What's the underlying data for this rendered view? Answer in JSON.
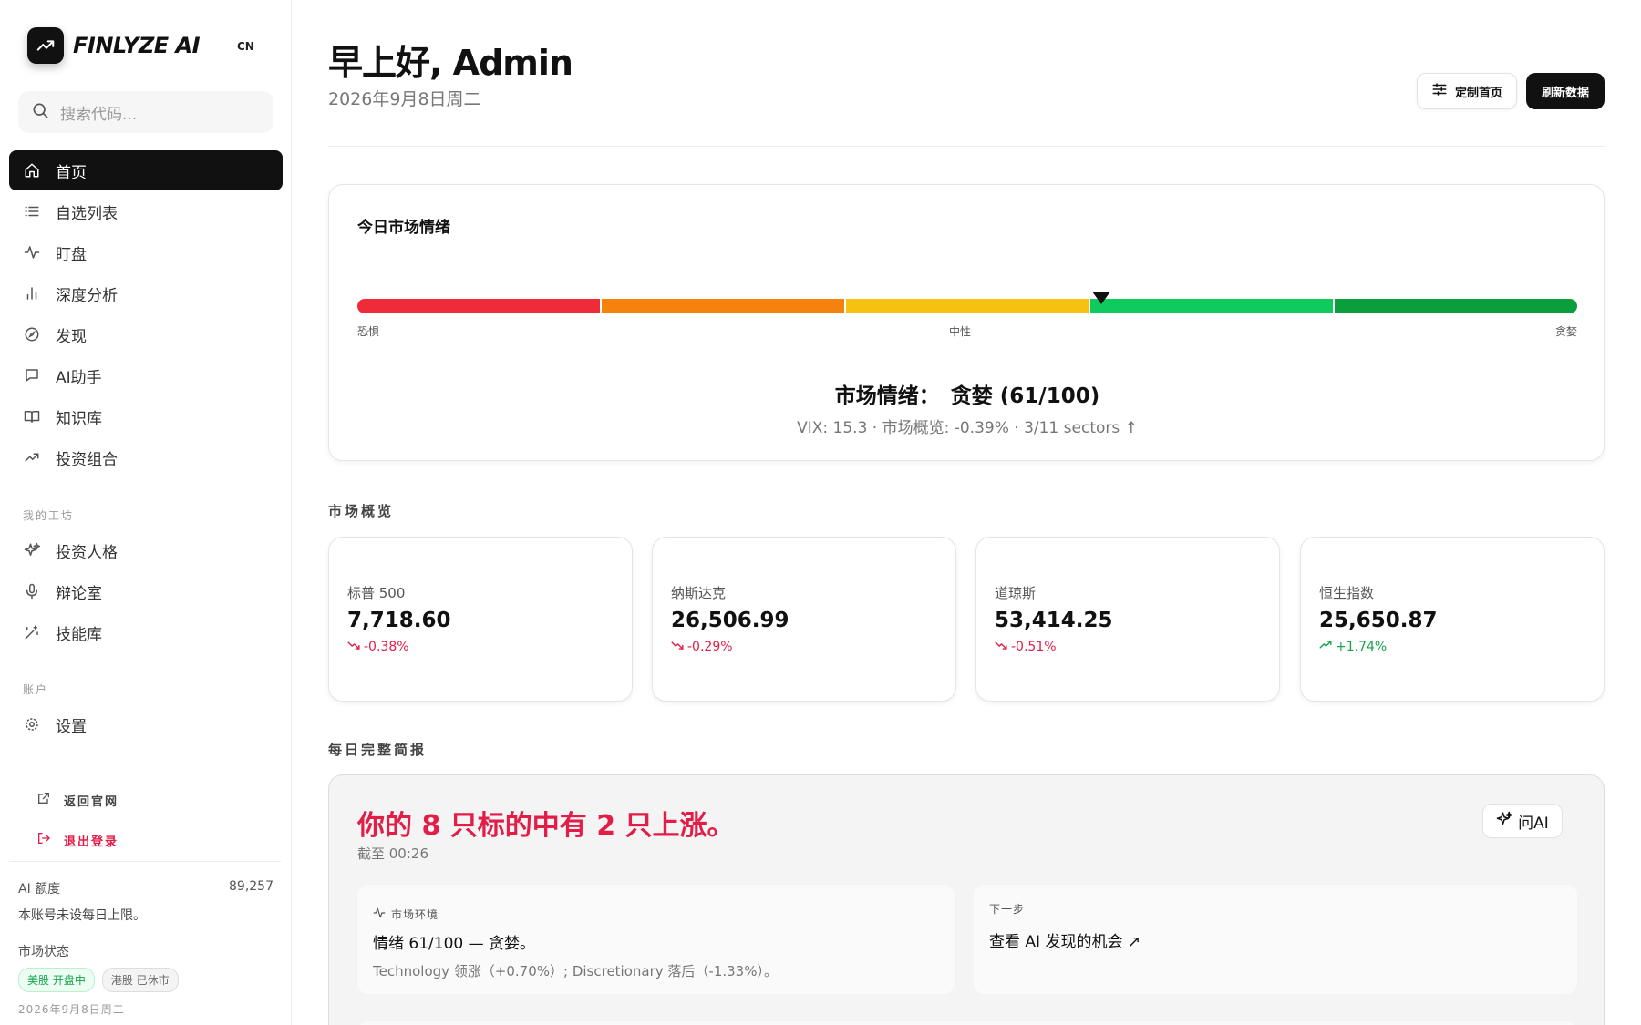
{
  "brand": {
    "name": "FINLYZE AI",
    "lang": "CN"
  },
  "search": {
    "placeholder": "搜索代码..."
  },
  "nav": [
    {
      "label": "首页",
      "icon": "home-icon",
      "active": true
    },
    {
      "label": "自选列表",
      "icon": "list-icon"
    },
    {
      "label": "盯盘",
      "icon": "pulse-icon"
    },
    {
      "label": "深度分析",
      "icon": "bar-chart-icon"
    },
    {
      "label": "发现",
      "icon": "compass-icon"
    },
    {
      "label": "AI助手",
      "icon": "chat-icon"
    },
    {
      "label": "知识库",
      "icon": "book-icon"
    },
    {
      "label": "投资组合",
      "icon": "trend-up-icon"
    }
  ],
  "workshop": {
    "title": "我的工坊",
    "items": [
      {
        "label": "投资人格",
        "icon": "sparkles-icon"
      },
      {
        "label": "辩论室",
        "icon": "mic-icon"
      },
      {
        "label": "技能库",
        "icon": "magic-wand-icon"
      }
    ]
  },
  "account": {
    "title": "账户",
    "items": [
      {
        "label": "设置",
        "icon": "gear-icon"
      }
    ]
  },
  "links": {
    "back": "返回官网",
    "logout": "退出登录"
  },
  "quota": {
    "label": "AI 额度",
    "value": "89,257",
    "note": "本账号未设每日上限。",
    "market_status_label": "市场状态",
    "us": "美股 开盘中",
    "hk": "港股 已休市",
    "date": "2026年9月8日周二"
  },
  "header": {
    "greeting": "早上好, Admin",
    "date": "2026年9月8日周二",
    "customize": "定制首页",
    "refresh": "刷新数据"
  },
  "sentiment": {
    "title": "今日市场情绪",
    "score": 61,
    "scale_max": 100,
    "label_low": "恐惧",
    "label_mid": "中性",
    "label_high": "贪婪",
    "headline": "市场情绪：",
    "value": "贪婪 (61/100)",
    "sub": "VIX: 15.3 · 市场概览: -0.39% · 3/11 sectors ↑",
    "colors": [
      "#ef2b3a",
      "#f5820d",
      "#f5c211",
      "#0fca5c",
      "#0a9e3c"
    ]
  },
  "overview": {
    "title": "市场概览",
    "indices": [
      {
        "name": "标普 500",
        "value": "7,718.60",
        "change": "-0.38%",
        "dir": "down"
      },
      {
        "name": "纳斯达克",
        "value": "26,506.99",
        "change": "-0.29%",
        "dir": "down"
      },
      {
        "name": "道琼斯",
        "value": "53,414.25",
        "change": "-0.51%",
        "dir": "down"
      },
      {
        "name": "恒生指数",
        "value": "25,650.87",
        "change": "+1.74%",
        "dir": "up"
      }
    ]
  },
  "brief": {
    "section": "每日完整简报",
    "title": "你的 8 只标的中有 2 只上涨。",
    "time": "截至 00:26",
    "ask_ai": "问AI",
    "env_label": "市场环境",
    "env_main": "情绪 61/100 — 贪婪。",
    "env_note": "Technology 领涨（+0.70%）; Discretionary 落后（-1.33%）。",
    "next_label": "下一步",
    "next_main": "查看 AI 发现的机会 ↗"
  }
}
